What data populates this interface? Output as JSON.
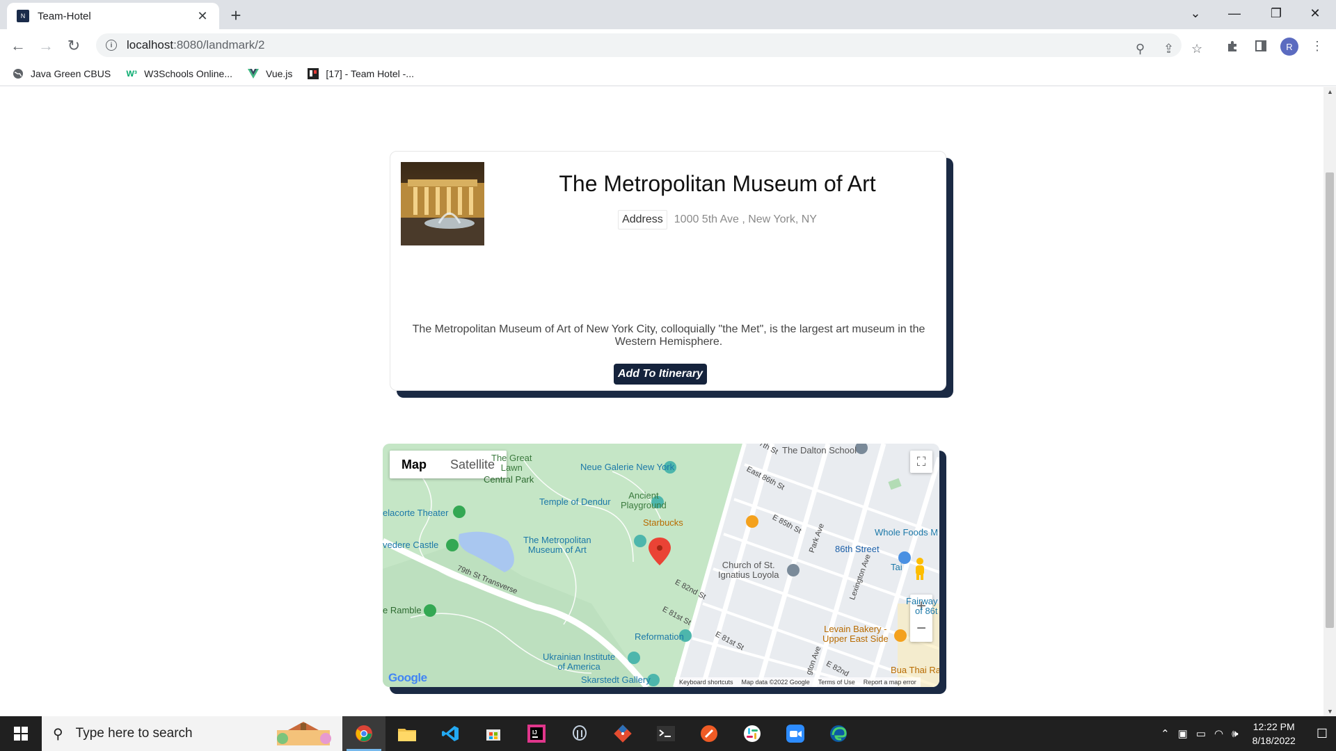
{
  "browser": {
    "tab_title": "Team-Hotel",
    "url_host": "localhost",
    "url_path": ":8080/landmark/2",
    "avatar_letter": "R",
    "bookmarks": [
      {
        "label": "Java Green CBUS"
      },
      {
        "label": "W3Schools Online..."
      },
      {
        "label": "Vue.js"
      },
      {
        "label": "[17] - Team Hotel -..."
      }
    ]
  },
  "landmark": {
    "name": "The Metropolitan Museum of Art",
    "address_label": "Address",
    "address_value": "1000 5th Ave , New York, NY",
    "description": "The Metropolitan Museum of Art of New York City, colloquially \"the Met\", is the largest art museum in the Western Hemisphere.",
    "add_button": "Add To Itinerary"
  },
  "map": {
    "type_map": "Map",
    "type_satellite": "Satellite",
    "labels": {
      "great_lawn": "The Great\nLawn",
      "central_park": "Central Park",
      "neue_galerie": "Neue Galerie New York",
      "temple": "Temple of Dendur",
      "ancient": "Ancient\nPlayground",
      "starbucks": "Starbucks",
      "delacorte": "elacorte Theater",
      "belvedere": "vedere Castle",
      "met": "The Metropolitan\nMuseum of Art",
      "transverse": "79th St Transverse",
      "ramble": "e Ramble",
      "church": "Church of St.\nIgnatius Loyola",
      "reformation": "Reformation",
      "ukrainian": "Ukrainian Institute\nof America",
      "skarstedt": "Skarstedt Gallery",
      "dalton": "The Dalton School",
      "whole_foods": "Whole Foods M",
      "st86": "86th Street",
      "levain": "Levain Bakery -\nUpper East Side",
      "fairway": "Fairway\nof 86t",
      "bua": "Bua Thai Ra",
      "tai": "Tai",
      "e86": "East 86th St",
      "e85": "E 85th St",
      "e82": "E 82nd St",
      "e81": "E 81st St",
      "e81b": "E 81st St",
      "park_ave": "Park Ave",
      "lexington": "Lexington Ave",
      "gton_ave": "gton Ave",
      "e82b": "E 82nd",
      "e7th": "7th St"
    },
    "footer": {
      "shortcuts": "Keyboard shortcuts",
      "map_data": "Map data ©2022 Google",
      "terms": "Terms of Use",
      "report": "Report a map error"
    },
    "google_logo": "Google"
  },
  "taskbar": {
    "search_placeholder": "Type here to search",
    "time": "12:22 PM",
    "date": "8/18/2022"
  },
  "colors": {
    "card_shadow": "#1b2a44",
    "button_bg": "#15233c",
    "park_green": "#c8e6c9",
    "map_pin": "#ea4335"
  }
}
